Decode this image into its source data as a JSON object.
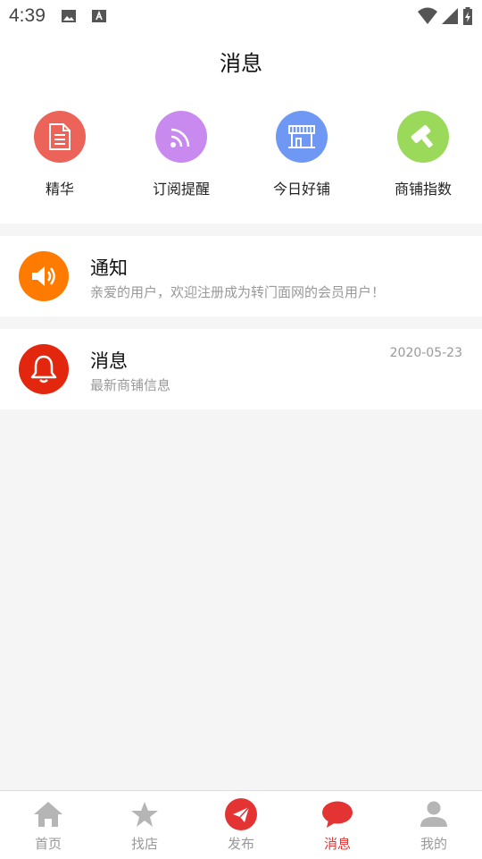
{
  "status_bar": {
    "time": "4:39"
  },
  "header": {
    "title": "消息"
  },
  "quick_links": [
    {
      "label": "精华",
      "color": "#ec6459",
      "icon": "document-icon"
    },
    {
      "label": "订阅提醒",
      "color": "#c98af0",
      "icon": "rss-icon"
    },
    {
      "label": "今日好铺",
      "color": "#6e98f3",
      "icon": "storefront-icon"
    },
    {
      "label": "商铺指数",
      "color": "#9bd95a",
      "icon": "hammer-icon"
    }
  ],
  "messages": [
    {
      "title": "通知",
      "subtitle": "亲爱的用户，欢迎注册成为转门面网的会员用户！",
      "date": "",
      "color": "#ff7b00",
      "icon": "speaker-icon"
    },
    {
      "title": "消息",
      "subtitle": "最新商铺信息",
      "date": "2020-05-23",
      "color": "#e3270f",
      "icon": "bell-icon"
    }
  ],
  "tabbar": {
    "active_color": "#e33333",
    "items": [
      {
        "label": "首页",
        "icon": "home-icon"
      },
      {
        "label": "找店",
        "icon": "star-icon"
      },
      {
        "label": "发布",
        "icon": "send-icon"
      },
      {
        "label": "消息",
        "icon": "chat-bubble-icon",
        "active": true
      },
      {
        "label": "我的",
        "icon": "person-icon"
      }
    ]
  }
}
